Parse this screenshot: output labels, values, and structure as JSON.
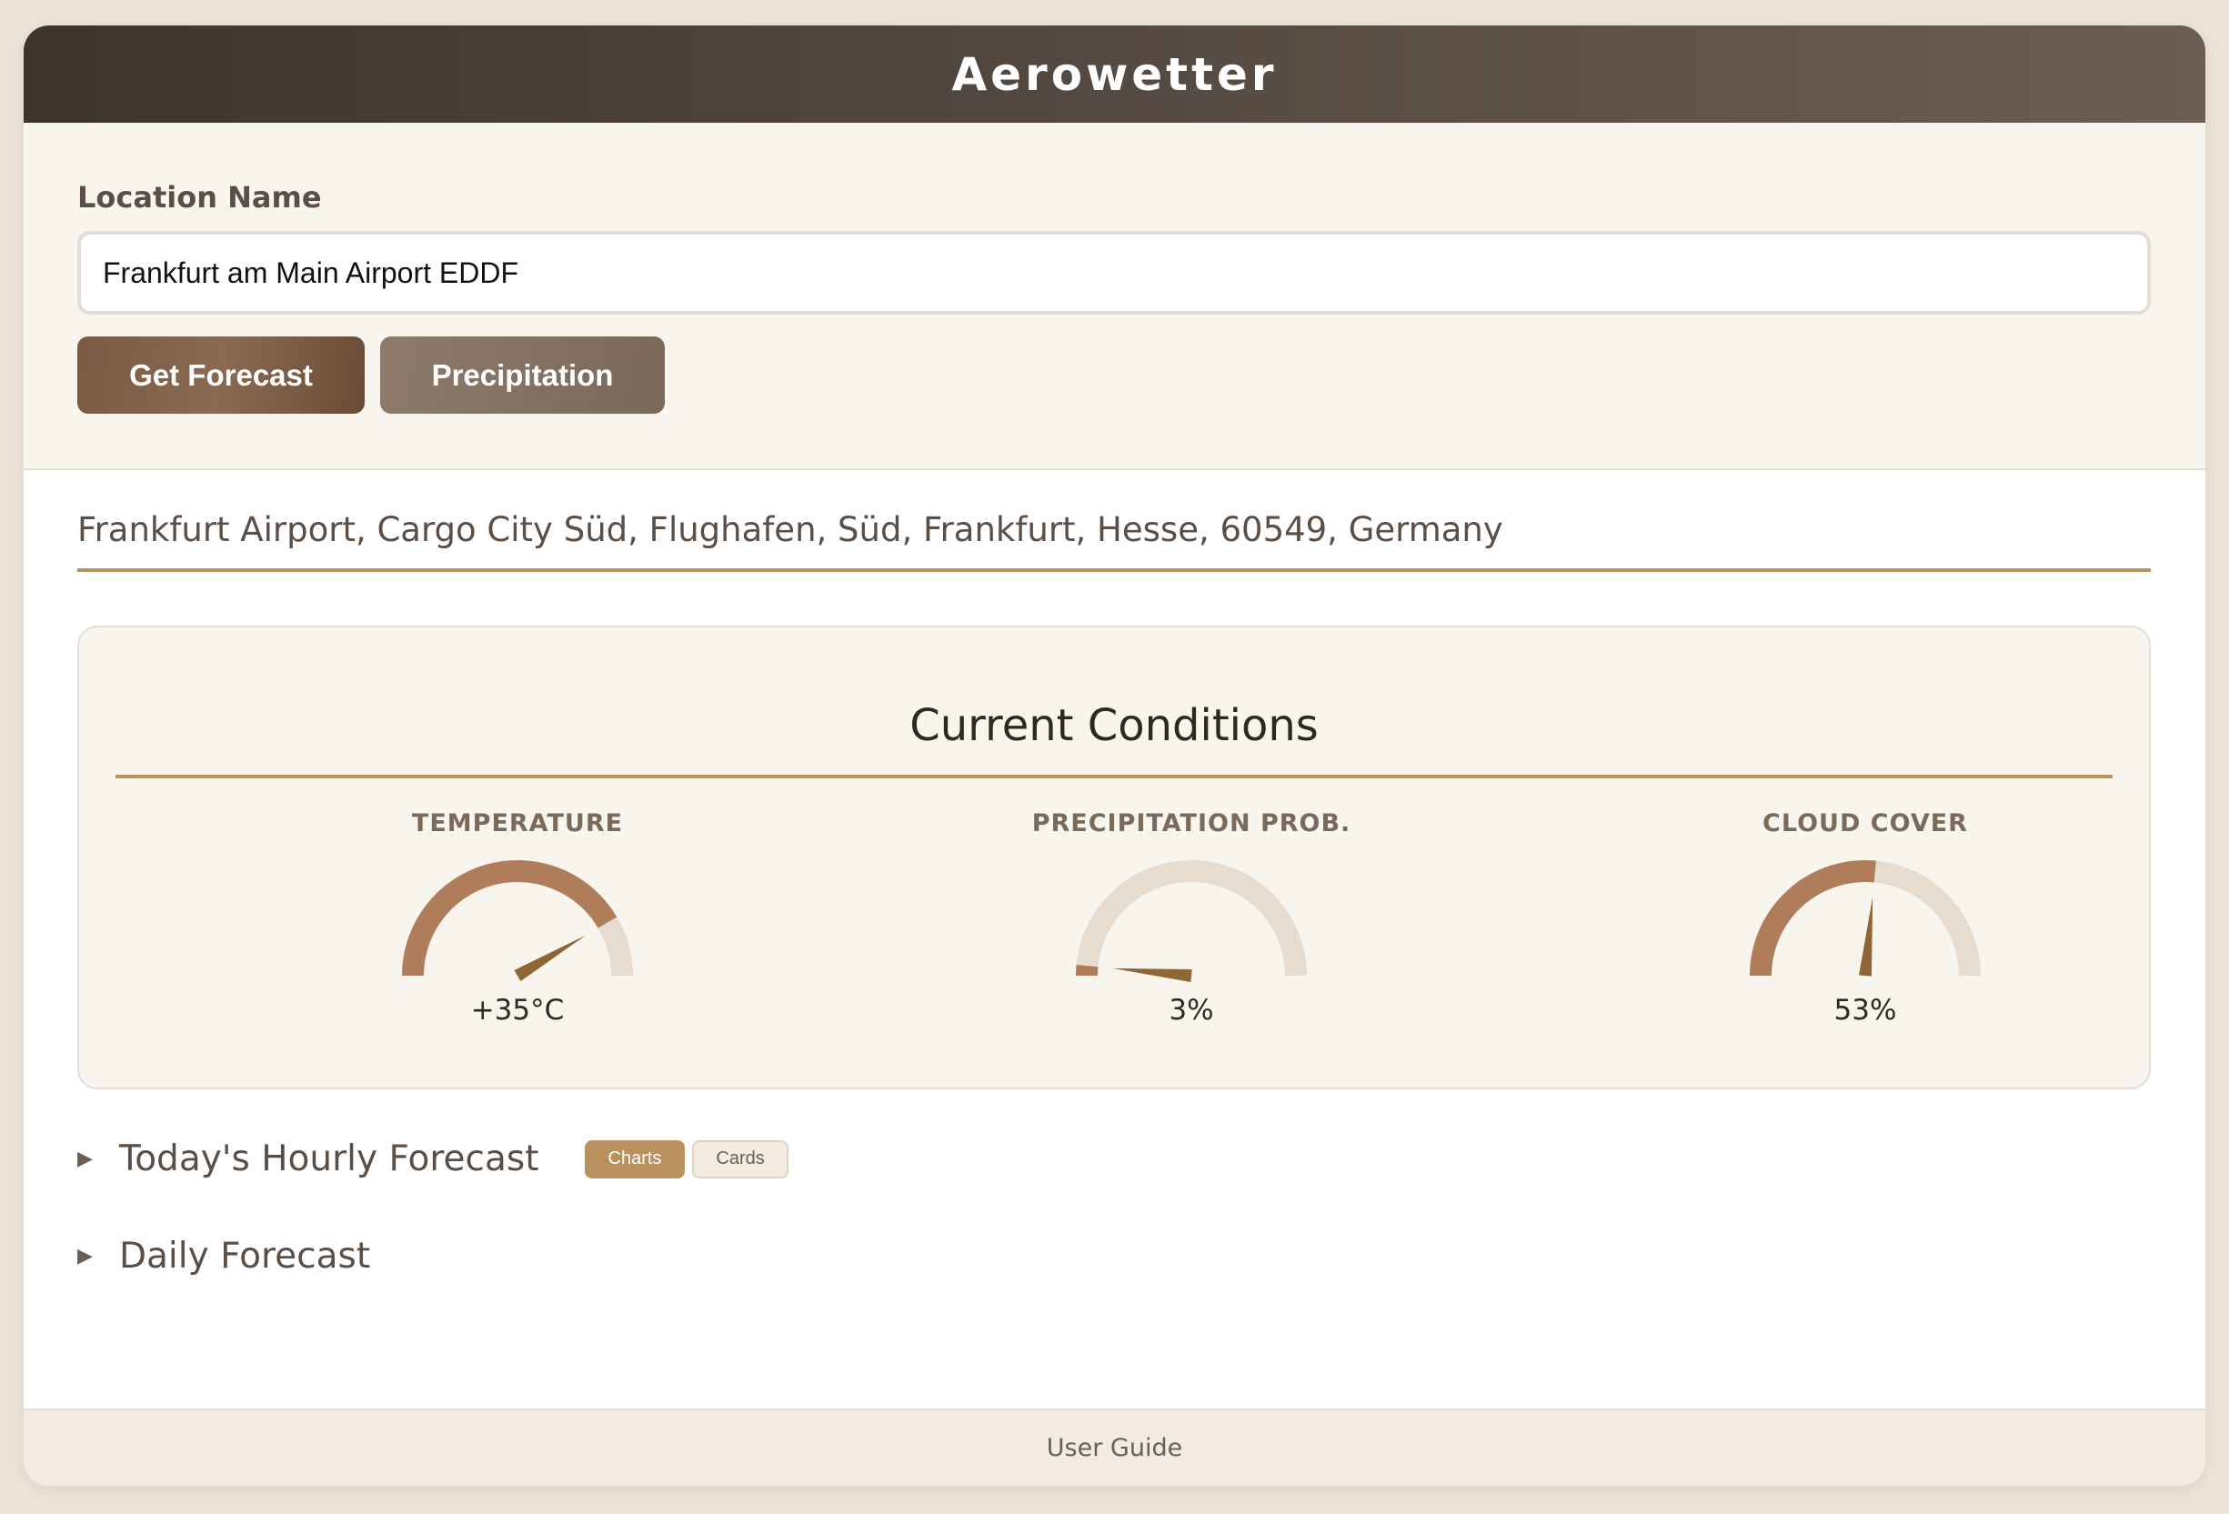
{
  "app": {
    "title": "Aerowetter"
  },
  "search": {
    "label": "Location Name",
    "value": "Frankfurt am Main Airport EDDF",
    "get_forecast_label": "Get Forecast",
    "precipitation_label": "Precipitation"
  },
  "location": {
    "address": "Frankfurt Airport, Cargo City Süd, Flughafen, Süd, Frankfurt, Hesse, 60549, Germany"
  },
  "current": {
    "title": "Current Conditions",
    "gauges": [
      {
        "label": "TEMPERATURE",
        "value_text": "+35°C",
        "fraction": 0.83
      },
      {
        "label": "PRECIPITATION PROB.",
        "value_text": "3%",
        "fraction": 0.03
      },
      {
        "label": "CLOUD COVER",
        "value_text": "53%",
        "fraction": 0.53
      }
    ]
  },
  "sections": {
    "hourly_title": "Today's Hourly Forecast",
    "charts_label": "Charts",
    "cards_label": "Cards",
    "daily_title": "Daily Forecast"
  },
  "footer": {
    "user_guide": "User Guide"
  },
  "colors": {
    "gauge_fill": "#b07d5b",
    "gauge_track": "#e6dccf",
    "gauge_needle": "#8f6535",
    "accent_rule": "#b8935e",
    "header_dark": "#3d3430"
  },
  "icons": {
    "collapse_marker": "triangle-right-icon"
  }
}
